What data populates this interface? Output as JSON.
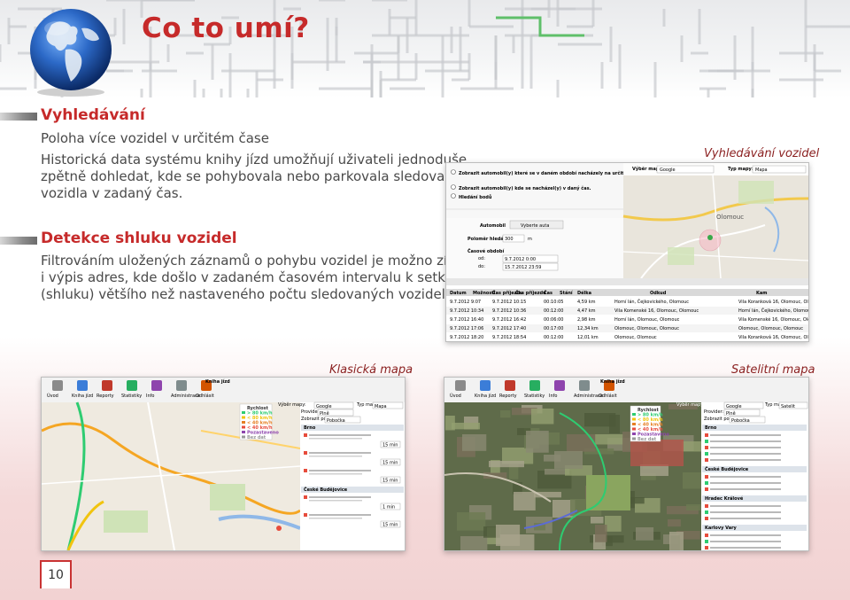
{
  "header": {
    "title": "Co to umí?"
  },
  "section1": {
    "heading": "Vyhledávání",
    "subheading": "Poloha více vozidel v určitém čase",
    "text_lines": [
      "Historická data systému knihy jízd umožňují uživateli jednoduše",
      "zpětně dohledat, kde se pohybovala nebo parkovala sledovaná",
      "vozidla v zadaný čas."
    ]
  },
  "section2": {
    "heading": "Detekce shluku vozidel",
    "text_lines": [
      "Filtrováním uložených záznamů o pohybu vozidel je možno získat",
      "i výpis adres, kde došlo v zadaném časovém intervalu k setkání",
      "(shluku) většího než nastaveného počtu sledovaných vozidel."
    ]
  },
  "captions": {
    "search": "Vyhledávání vozidel",
    "classic": "Klasická mapa",
    "satellite": "Satelitní mapa"
  },
  "page_number": "10",
  "search_shot": {
    "radio_options": [
      "Zobrazit automobil(y) které se v daném období nacházely na určitém místě.",
      "Zobrazit automobil(y) kde se nacházel(y) v daný čas.",
      "Hledání bodů"
    ],
    "map_type_label": "Výběr mapy:",
    "map_type_value": "Google",
    "type_label": "Typ mapy:",
    "type_value": "Mapa",
    "city": "Olomouc",
    "vehicle_label": "Automobil",
    "choose_car": "Vyberte auta",
    "radius_label": "Poloměr hledání",
    "radius_value": "300",
    "radius_unit": "m",
    "time_label": "Časové období",
    "from_label": "od:",
    "from_value": "9.7.2012 0:00",
    "to_label": "do:",
    "to_value": "15.7.2012 23:59",
    "table_headers": [
      "Datum",
      "Možnosti",
      "Čas příjezdu",
      "Čas příjezdu",
      "Čas",
      "Stání",
      "Délka",
      "Odkud",
      "Kam"
    ],
    "table_rows": [
      [
        "9.7.2012 9:07",
        "9.7.2012 10:15",
        "00:10:05",
        "4,59 km",
        "Horní lán, Čejkovického, Olomouc",
        "Vila Koranková 16, Olomouc, Olomouc"
      ],
      [
        "9.7.2012 10:34",
        "9.7.2012 10:36",
        "00:12:00",
        "4,47 km",
        "Vila Komenské 16, Olomouc, Olomouc",
        "Horní lán, Čejkovického, Olomouc"
      ],
      [
        "9.7.2012 16:40",
        "9.7.2012 16:42",
        "00:06:00",
        "2,98 km",
        "Horní lán, Olomouc, Olomouc",
        "Vila Komenské 16, Olomouc, Olomouc"
      ],
      [
        "9.7.2012 17:06",
        "9.7.2012 17:40",
        "00:17:00",
        "12,34 km",
        "Olomouc, Olomouc, Olomouc",
        "Olomouc, Olomouc, Olomouc"
      ],
      [
        "9.7.2012 18:20",
        "9.7.2012 18:54",
        "00:12:00",
        "12,01 km",
        "Olomouc, Olomouc",
        "Vila Koranková 16, Olomouc, Olomouc"
      ]
    ]
  },
  "map_shots": {
    "app_title": "Kniha jízd",
    "toolbar": [
      "Úvod",
      "Kniha jízd",
      "Reporty",
      "Statistiky",
      "Info",
      "Administrace",
      "Odhlásit"
    ],
    "map_select_label": "Výběr mapy:",
    "map_select_value": "Google",
    "type_label": "Typ mapy:",
    "type_value_classic": "Mapa",
    "type_value_sat": "Satelit",
    "provider_label": "Provider:",
    "provider_value": "Plně",
    "search_label": "Zobrazit podle:",
    "search_value": "Pobočka",
    "speed_legend": [
      "Rychlost",
      "> 80 km/h",
      "< 80 km/h",
      "< 40 km/h",
      "< 40 km/h",
      "Pozastaveno",
      "Bez dat"
    ],
    "list_groups": [
      "Brno",
      "České Budějovice"
    ],
    "sat_groups": [
      "Brno",
      "České Budějovice",
      "Hradec Králové",
      "Karlovy Vary"
    ],
    "minutes": [
      "15 min",
      "15 min",
      "15 min",
      "1 min",
      "15 min"
    ]
  },
  "colors": {
    "accent": "#c62a2a",
    "text": "#4a4a4a",
    "caption": "#8a1f1f"
  }
}
